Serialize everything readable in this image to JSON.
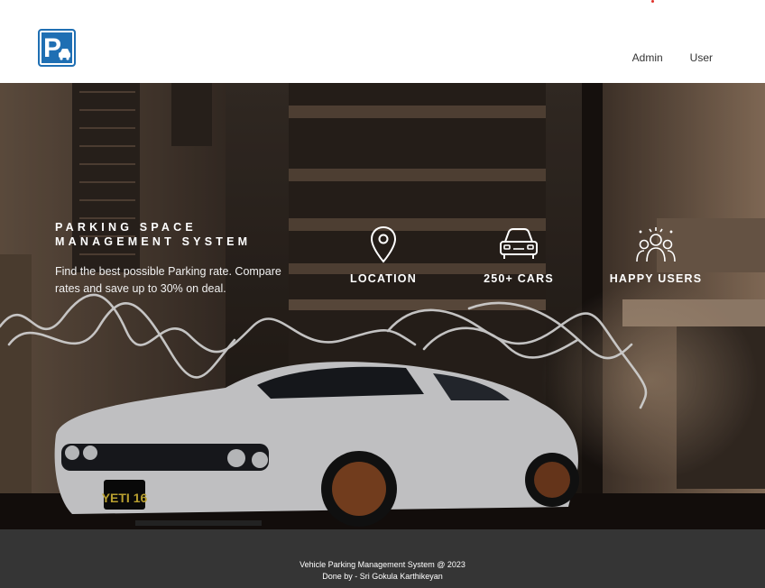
{
  "header": {
    "logo_icon": "parking-car-icon",
    "nav": [
      {
        "label": "Admin"
      },
      {
        "label": "User"
      }
    ]
  },
  "hero": {
    "title": "PARKING SPACE\nMANAGEMENT SYSTEM",
    "description": "Find the best possible Parking rate. Compare rates and save up to 30% on deal.",
    "background_image": "white muscle car in parking garage with light painting",
    "license_plate": "YETI 16",
    "stats": [
      {
        "icon": "location-pin-icon",
        "label": "LOCATION"
      },
      {
        "icon": "car-front-icon",
        "label": "250+ CARS"
      },
      {
        "icon": "happy-users-icon",
        "label": "HAPPY USERS"
      }
    ]
  },
  "footer": {
    "line1": "Vehicle Parking Management System @ 2023",
    "line2": "Done by - Sri Gokula Karthikeyan"
  },
  "colors": {
    "brand": "#1f6fb3",
    "footer_bg": "#353535",
    "accent_dot": "#e0322a"
  }
}
